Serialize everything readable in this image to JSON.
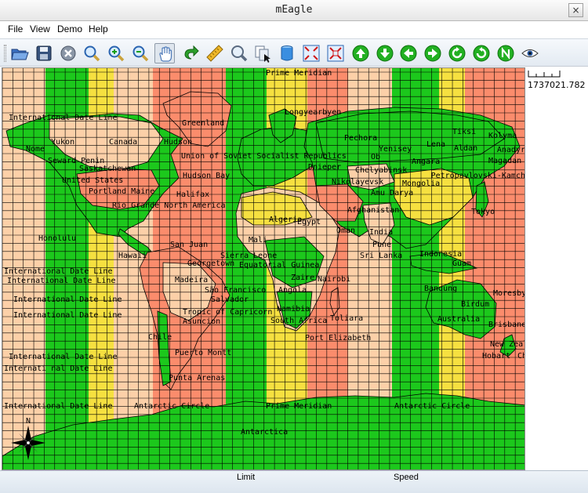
{
  "window": {
    "title": "mEagle",
    "close_glyph": "×"
  },
  "menu": {
    "items": [
      "File",
      "View",
      "Demo",
      "Help"
    ]
  },
  "toolbar": {
    "buttons": [
      "open-folder-icon",
      "save-disk-icon",
      "stop-icon",
      "zoom-icon",
      "zoom-in-icon",
      "zoom-out-icon",
      "pan-hand-icon",
      "refresh-icon",
      "ruler-icon",
      "find-icon",
      "copy-icon",
      "database-icon",
      "fit-extent-icon",
      "full-extent-icon",
      "arrow-up-icon",
      "arrow-down-icon",
      "arrow-left-icon",
      "arrow-right-icon",
      "rotate-left-icon",
      "rotate-right-icon",
      "north-icon",
      "eye-icon"
    ]
  },
  "scale": {
    "text": "1737021.782 m"
  },
  "status": {
    "left": "Limit",
    "right": "Speed"
  },
  "map": {
    "labels": {
      "prime_meridian_top": "Prime Meridian",
      "prime_meridian_bottom": "Prime Meridian",
      "intl_date_line": "International Date Line",
      "intl_date_line_partial": "Internati nal Date Line",
      "antarctic_circle_left": "Antarctic Circle",
      "antarctic_circle_right": "Antarctic Circle",
      "antarctica": "Antarctica",
      "greenland": "Greenland",
      "canada": "Canada",
      "yukon": "Yukon",
      "nome": "Nome",
      "seward_penin": "Seward Penin",
      "saskatchewan": "Saskatchewan",
      "united_states": "United States",
      "portland_maine": "Portland Maine",
      "rio_grande": "Rio Grande North America",
      "hudson": "Hudson",
      "halifax": "Halifax",
      "hudson_bay": "Hudson Bay",
      "honolulu": "Honolulu",
      "san_juan": "San Juan",
      "georgetown": "Georgetown",
      "madeira": "Madeira",
      "sao_francisco": "São Francisco",
      "salvador": "Salvador",
      "tropic": "Tropic of Capricorn",
      "asuncion": "Asuncion",
      "chile": "Chile",
      "puerto_montt": "Puerto Montt",
      "punta_arenas": "Punta Arenas",
      "union_soviet": "Union of Soviet Socialist Republics",
      "longuearbyen": "Longyearbyen",
      "pechora": "Pechora",
      "yenisey": "Yenisey",
      "ob": "Ob",
      "angara": "Angara",
      "lena": "Lena",
      "aldan": "Aldan",
      "tiksi": "Tiksi",
      "kolyma": "Kolyma",
      "anadyr": "Anadyr",
      "magadan": "Magadan",
      "petropavlovsk": "Petropavlovski-Kamch",
      "dnieper": "Dnieper",
      "chelyabinsk": "Chelyabinsk",
      "nikolayevsk": "Nikolayevsk",
      "mongolia": "Mongolia",
      "amu_darya": "Amu Darya",
      "afghanistan": "Afghanistan",
      "tokyo": "Tokyo",
      "india": "India",
      "pune": "Pune",
      "sri_lanka": "Sri Lanka",
      "algeria": "Algeria",
      "egypt": "Egypt",
      "oman": "Oman",
      "mali": "Mali",
      "sierra_leone": "Sierra Leone",
      "equatorial_guinea": "Equatorial Guinea",
      "zaire": "Zaire",
      "nairobi": "Nairobi",
      "angola": "Angola",
      "namibia": "Namibia",
      "south_africa": "South Africa",
      "toliara": "Toliara",
      "port_elizabeth": "Port Elizabeth",
      "indonesia": "Indonesia",
      "bandung": "Bandung",
      "australia": "Australia",
      "brisbane": "Brisbane",
      "birdum": "Birdum",
      "moresby": "Moresby",
      "new_zealand": "New Zealand",
      "hobart": "Hobart",
      "christchurch": "Christchurch",
      "guam": "Guam",
      "hawaii": "Hawaii"
    },
    "colors": {
      "salmon": "#fb8c6c",
      "peach": "#fcd0a8",
      "yellow": "#f6e040",
      "green": "#1cc81c",
      "grid": "#000000"
    },
    "compass_letter": "N"
  }
}
